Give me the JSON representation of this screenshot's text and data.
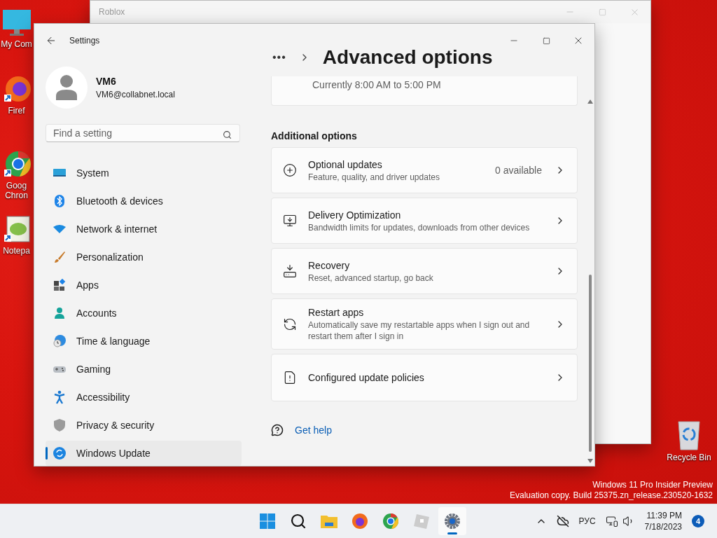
{
  "desktop_icons": [
    {
      "lines": [
        "My Com"
      ]
    },
    {
      "lines": [
        "Firef"
      ]
    },
    {
      "lines": [
        "Goog",
        "Chron"
      ]
    },
    {
      "lines": [
        "Notepa"
      ]
    },
    {
      "lines": [
        "Recycle Bin"
      ]
    }
  ],
  "background_window": {
    "title": "Roblox"
  },
  "window": {
    "title": "Settings"
  },
  "profile": {
    "name": "VM6",
    "email": "VM6@collabnet.local"
  },
  "search": {
    "placeholder": "Find a setting"
  },
  "sidebar": {
    "items": [
      {
        "label": "System",
        "selected": false
      },
      {
        "label": "Bluetooth & devices",
        "selected": false
      },
      {
        "label": "Network & internet",
        "selected": false
      },
      {
        "label": "Personalization",
        "selected": false
      },
      {
        "label": "Apps",
        "selected": false
      },
      {
        "label": "Accounts",
        "selected": false
      },
      {
        "label": "Time & language",
        "selected": false
      },
      {
        "label": "Gaming",
        "selected": false
      },
      {
        "label": "Accessibility",
        "selected": false
      },
      {
        "label": "Privacy & security",
        "selected": false
      },
      {
        "label": "Windows Update",
        "selected": true
      }
    ]
  },
  "header": {
    "breadcrumb_more": "•••",
    "title": "Advanced options"
  },
  "partial_card": {
    "subtitle": "Currently 8:00 AM to 5:00 PM"
  },
  "section_title": "Additional options",
  "cards": [
    {
      "title": "Optional updates",
      "subtitle": "Feature, quality, and driver updates",
      "value": "0 available"
    },
    {
      "title": "Delivery Optimization",
      "subtitle": "Bandwidth limits for updates, downloads from other devices"
    },
    {
      "title": "Recovery",
      "subtitle": "Reset, advanced startup, go back"
    },
    {
      "title": "Restart apps",
      "subtitle": "Automatically save my restartable apps when I sign out and restart them after I sign in"
    },
    {
      "title": "Configured update policies"
    }
  ],
  "help_link": "Get help",
  "watermark": [
    "Windows 11 Pro Insider Preview",
    "Evaluation copy. Build 25375.zn_release.230520-1632"
  ],
  "taskbar": {
    "apps": [
      {
        "selected": false
      },
      {
        "selected": false
      },
      {
        "selected": false
      },
      {
        "selected": false
      },
      {
        "selected": false
      },
      {
        "selected": false
      },
      {
        "selected": true
      }
    ],
    "language": "РУС",
    "time": "11:39 PM",
    "date": "7/18/2023",
    "badge": "4"
  }
}
